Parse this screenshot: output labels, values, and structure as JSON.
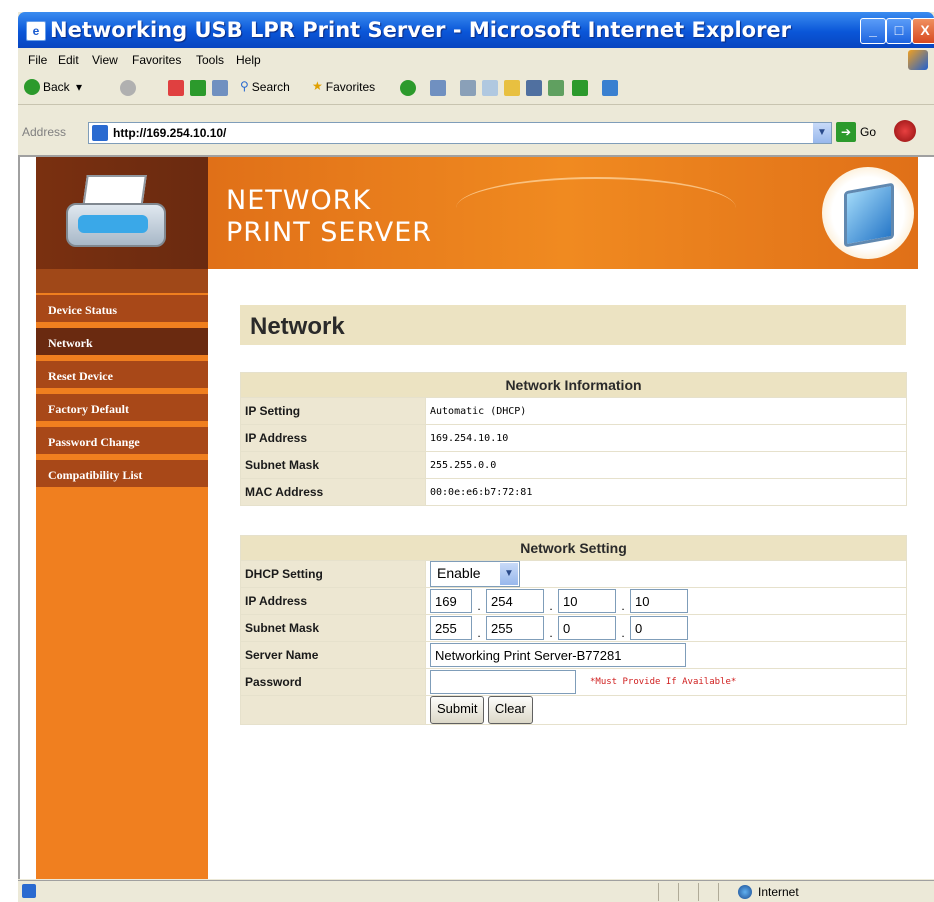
{
  "window": {
    "title": "Networking USB LPR Print Server - Microsoft Internet Explorer",
    "min_label": "_",
    "max_label": "□",
    "close_label": "X"
  },
  "menu": [
    "File",
    "Edit",
    "View",
    "Favorites",
    "Tools",
    "Help"
  ],
  "toolbar": {
    "back_label": "Back",
    "search_label": "Search",
    "favorites_label": "Favorites"
  },
  "address": {
    "label": "Address",
    "url": "http://169.254.10.10/",
    "go_label": "Go"
  },
  "banner": {
    "title": "NETWORK\nPRINT SERVER"
  },
  "sidebar": {
    "items": [
      {
        "label": "Device Status"
      },
      {
        "label": "Network"
      },
      {
        "label": "Reset Device"
      },
      {
        "label": "Factory Default"
      },
      {
        "label": "Password Change"
      },
      {
        "label": "Compatibility List"
      }
    ]
  },
  "page": {
    "heading": "Network"
  },
  "network_info": {
    "header": "Network Information",
    "rows": [
      {
        "label": "IP Setting",
        "value": "Automatic (DHCP)"
      },
      {
        "label": "IP Address",
        "value": "169.254.10.10"
      },
      {
        "label": "Subnet Mask",
        "value": "255.255.0.0"
      },
      {
        "label": "MAC Address",
        "value": "00:0e:e6:b7:72:81"
      }
    ]
  },
  "network_setting": {
    "header": "Network Setting",
    "dhcp_label": "DHCP Setting",
    "dhcp_value": "Enable",
    "ip_label": "IP Address",
    "ip": [
      "169",
      "254",
      "10",
      "10"
    ],
    "mask_label": "Subnet Mask",
    "mask": [
      "255",
      "255",
      "0",
      "0"
    ],
    "name_label": "Server Name",
    "name_value": "Networking Print Server-B77281",
    "password_label": "Password",
    "password_value": "",
    "password_note": "*Must Provide If Available*",
    "submit_label": "Submit",
    "clear_label": "Clear"
  },
  "status": {
    "zone": "Internet"
  }
}
